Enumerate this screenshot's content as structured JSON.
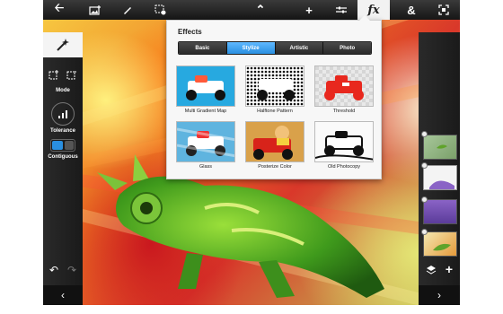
{
  "effects": {
    "title": "Effects",
    "tabs": [
      "Basic",
      "Stylize",
      "Artistic",
      "Photo"
    ],
    "active_tab": "Stylize",
    "items": [
      {
        "label": "Multi Gradient Map",
        "icon": "race-car-blue-thumb"
      },
      {
        "label": "Halftone Pattern",
        "icon": "race-car-halftone-thumb"
      },
      {
        "label": "Threshold",
        "icon": "race-car-red-threshold-thumb"
      },
      {
        "label": "Glass",
        "icon": "race-car-glass-thumb"
      },
      {
        "label": "Posterize Color",
        "icon": "race-car-poster-thumb"
      },
      {
        "label": "Old Photocopy",
        "icon": "race-car-photocopy-thumb"
      }
    ]
  },
  "left_panel": {
    "mode_label": "Mode",
    "tolerance_label": "Tolerance",
    "contiguous_label": "Contiguous"
  },
  "colors": {
    "toolbar": "#1e1e1e",
    "accent": "#2a8fe0",
    "panel": "#222222"
  }
}
